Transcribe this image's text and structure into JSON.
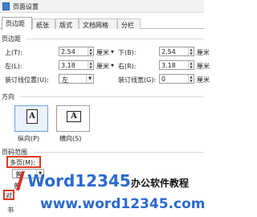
{
  "window": {
    "title": "页面设置"
  },
  "tabs": [
    {
      "label": "页边距",
      "active": true
    },
    {
      "label": "纸张",
      "active": false
    },
    {
      "label": "版式",
      "active": false
    },
    {
      "label": "文档网格",
      "active": false
    },
    {
      "label": "分栏",
      "active": false
    }
  ],
  "margins": {
    "section_label": "页边距",
    "top": {
      "label": "上(T):",
      "value": "2.54",
      "unit": "厘米"
    },
    "bottom": {
      "label": "下(B):",
      "value": "2.54",
      "unit": "厘米"
    },
    "left": {
      "label": "左(L):",
      "value": "3.18",
      "unit": "厘米"
    },
    "right": {
      "label": "右(R):",
      "value": "3.18",
      "unit": "厘米"
    },
    "gutter_pos": {
      "label": "装订线位置(U):",
      "value": "左"
    },
    "gutter": {
      "label": "装订线宽(G):",
      "value": "0",
      "unit": "厘米"
    }
  },
  "orientation": {
    "section_label": "方向",
    "glyph": "A",
    "portrait": {
      "label": "纵向(P)",
      "selected": true
    },
    "landscape": {
      "label": "横向(S)",
      "selected": false
    }
  },
  "page_range": {
    "section_label": "页码范围",
    "multiple_pages_label": "多页(M):",
    "select_value": "普",
    "partial_1": "普",
    "partial_2": "对",
    "partial_3": "书"
  },
  "watermark": {
    "brand": "Word12345",
    "tagline": "办公软件教程",
    "url": "www.word12345.com"
  },
  "colors": {
    "highlight_red": "#e03a28",
    "brand_blue": "#2a6ad0",
    "logo_red": "#d8332b"
  }
}
